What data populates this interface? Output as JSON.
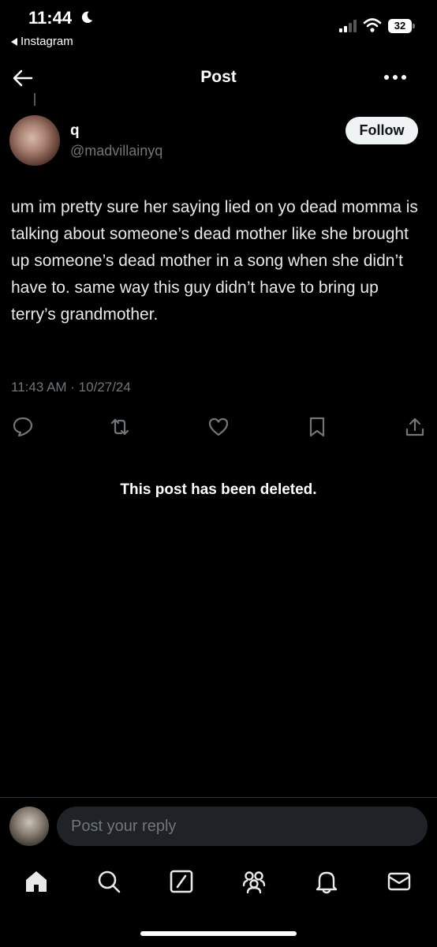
{
  "status_bar": {
    "time": "11:44",
    "back_app": "Instagram",
    "battery": "32"
  },
  "header": {
    "title": "Post"
  },
  "post": {
    "display_name": "q",
    "handle": "@madvillainyq",
    "follow_label": "Follow",
    "text": "um im pretty sure her saying lied on yo dead momma is talking about someone’s dead mother like she brought up someone’s dead mother in a song when she didn’t have to. same way this guy didn’t have to bring up terry’s grandmother.",
    "timestamp": "11:43 AM · 10/27/24"
  },
  "deleted_notice": "This post has been deleted.",
  "reply": {
    "placeholder": "Post your reply"
  },
  "icons": {
    "actions": [
      "reply-icon",
      "repost-icon",
      "like-icon",
      "bookmark-icon",
      "share-icon"
    ],
    "tabs": [
      "home-icon",
      "search-icon",
      "compose-icon",
      "communities-icon",
      "notifications-icon",
      "messages-icon"
    ]
  },
  "colors": {
    "background": "#000000",
    "text": "#e7e9ea",
    "muted": "#71767b",
    "follow_bg": "#eff3f4",
    "input_bg": "#1f2226"
  }
}
